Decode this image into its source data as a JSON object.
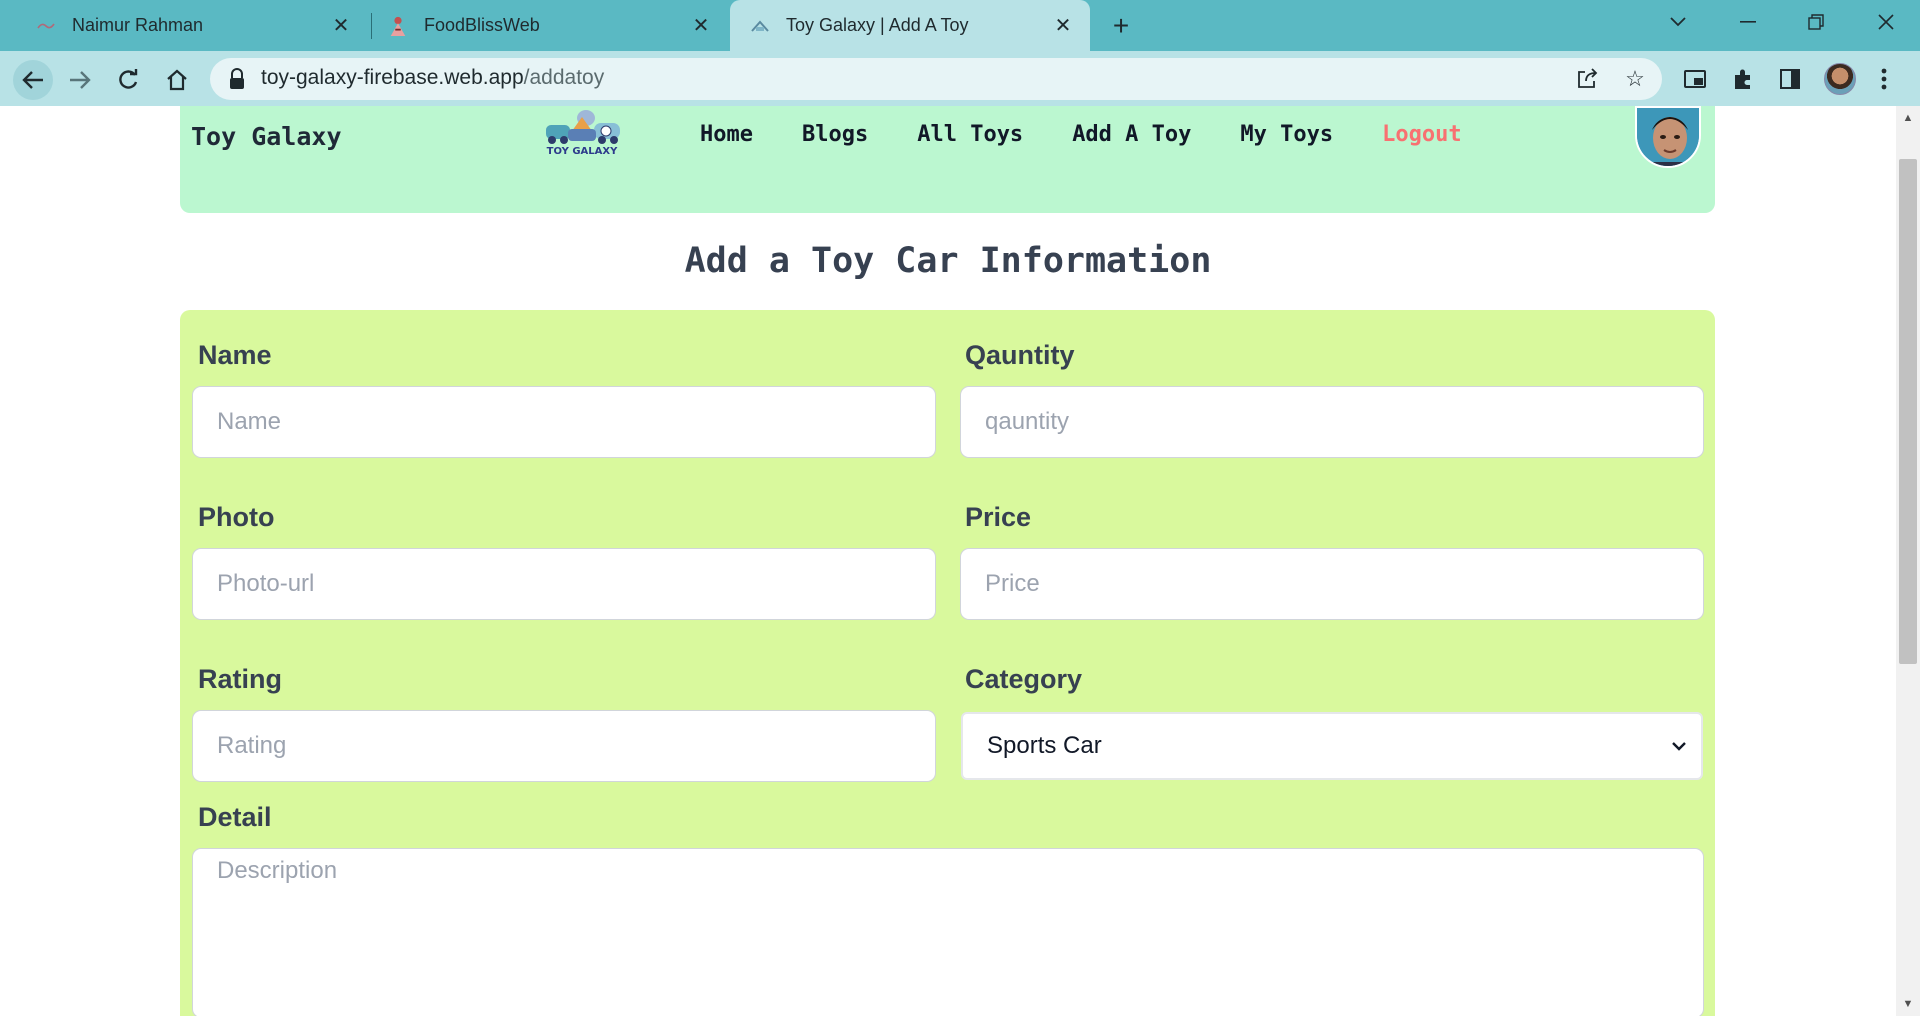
{
  "browser": {
    "tabs": [
      {
        "title": "Naimur Rahman",
        "active": false
      },
      {
        "title": "FoodBlissWeb",
        "active": false
      },
      {
        "title": "Toy Galaxy | Add A Toy",
        "active": true
      }
    ],
    "url_host": "toy-galaxy-firebase.web.app",
    "url_path": "/addatoy",
    "accent_color": "#5ab9c3"
  },
  "site": {
    "brand": "Toy Galaxy",
    "logo_text": "TOY GALAXY",
    "nav": [
      {
        "label": "Home"
      },
      {
        "label": "Blogs"
      },
      {
        "label": "All Toys"
      },
      {
        "label": "Add A Toy"
      },
      {
        "label": "My Toys"
      },
      {
        "label": "Logout"
      }
    ],
    "navbar_color": "#bbf7d0"
  },
  "page": {
    "title": "Add a Toy Car Information"
  },
  "form": {
    "bg_color": "#d9f99d",
    "name": {
      "label": "Name",
      "placeholder": "Name"
    },
    "quantity": {
      "label": "Qauntity",
      "placeholder": "qauntity"
    },
    "photo": {
      "label": "Photo",
      "placeholder": "Photo-url"
    },
    "price": {
      "label": "Price",
      "placeholder": "Price"
    },
    "rating": {
      "label": "Rating",
      "placeholder": "Rating"
    },
    "category": {
      "label": "Category",
      "value": "Sports Car"
    },
    "detail": {
      "label": "Detail",
      "placeholder": "Description"
    }
  }
}
